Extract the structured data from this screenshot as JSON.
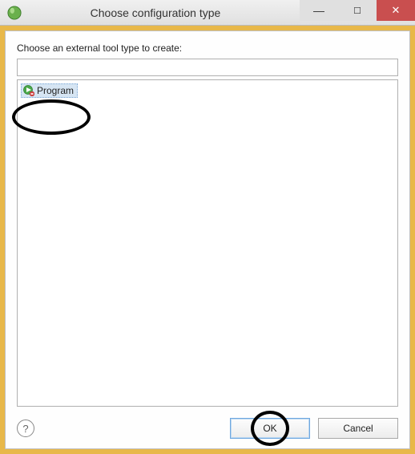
{
  "titlebar": {
    "title": "Choose configuration type"
  },
  "dialog": {
    "prompt": "Choose an external tool type to create:",
    "filter_value": "",
    "filter_placeholder": ""
  },
  "list": {
    "items": [
      {
        "label": "Program",
        "icon": "program-run-icon"
      }
    ]
  },
  "buttons": {
    "help": "?",
    "ok": "OK",
    "cancel": "Cancel"
  }
}
